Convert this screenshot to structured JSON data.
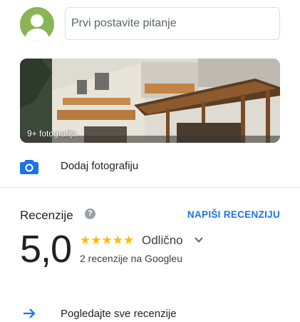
{
  "question": {
    "placeholder": "Prvi postavite pitanje"
  },
  "photos": {
    "count_label": "9+ fotografija"
  },
  "add_photo": {
    "icon": "camera-icon",
    "label": "Dodaj fotografiju"
  },
  "reviews": {
    "title": "Recenzije",
    "help_icon": "?",
    "write_label": "NAPIŠI RECENZIJU",
    "rating": "5,0",
    "stars": "★★★★★",
    "rating_value": 5,
    "rating_word": "Odlično",
    "count_label": "2 recenzije na Googleu",
    "see_all_label": "Pogledajte sve recenzije"
  },
  "colors": {
    "accent": "#1a73e8",
    "star": "#fbbc04",
    "avatar": "#8ab456"
  }
}
